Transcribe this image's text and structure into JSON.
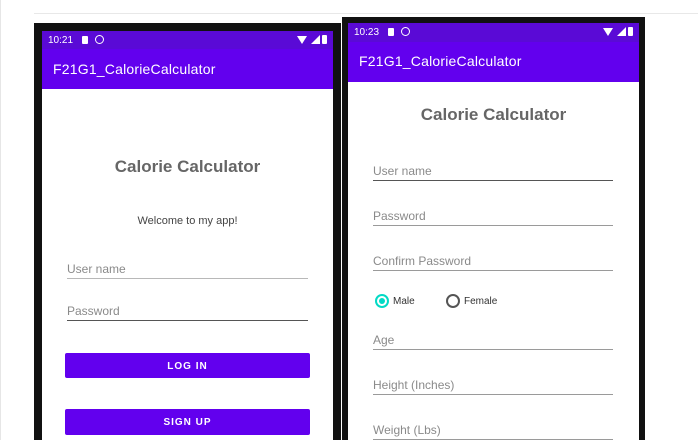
{
  "phone1": {
    "status_time": "10:21",
    "app_title": "F21G1_CalorieCalculator",
    "heading": "Calorie Calculator",
    "welcome": "Welcome to my app!",
    "username_placeholder": "User name",
    "password_placeholder": "Password",
    "login_label": "LOG IN",
    "signup_label": "SIGN UP"
  },
  "phone2": {
    "status_time": "10:23",
    "app_title": "F21G1_CalorieCalculator",
    "heading": "Calorie Calculator",
    "username_placeholder": "User name",
    "password_placeholder": "Password",
    "confirm_password_placeholder": "Confirm Password",
    "gender_options": [
      "Male",
      "Female"
    ],
    "gender_selected": "Male",
    "age_placeholder": "Age",
    "height_placeholder": "Height (Inches)",
    "weight_placeholder": "Weight (Lbs)"
  },
  "colors": {
    "status_bar": "#5a0ad6",
    "app_bar": "#6200ee",
    "primary_button": "#6200ee",
    "radio_accent": "#03dac5"
  },
  "icons": [
    "sd-card-icon",
    "settings-icon",
    "wifi-icon",
    "signal-icon",
    "battery-icon"
  ]
}
